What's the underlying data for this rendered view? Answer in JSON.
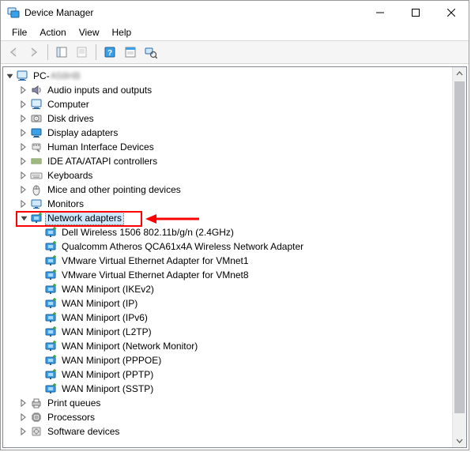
{
  "window": {
    "title": "Device Manager"
  },
  "menu": {
    "file": "File",
    "action": "Action",
    "view": "View",
    "help": "Help"
  },
  "tree": {
    "root": {
      "prefix": "PC-",
      "obscured": "A58HB"
    },
    "cat": {
      "audio": "Audio inputs and outputs",
      "computer": "Computer",
      "disk": "Disk drives",
      "display": "Display adapters",
      "hid": "Human Interface Devices",
      "ide": "IDE ATA/ATAPI controllers",
      "keyboards": "Keyboards",
      "mice": "Mice and other pointing devices",
      "monitors": "Monitors",
      "network": "Network adapters",
      "printq": "Print queues",
      "processors": "Processors",
      "softdev": "Software devices"
    },
    "net": {
      "dell1506": "Dell Wireless 1506 802.11b/g/n (2.4GHz)",
      "qca": "Qualcomm Atheros QCA61x4A Wireless Network Adapter",
      "vmnet1": "VMware Virtual Ethernet Adapter for VMnet1",
      "vmnet8": "VMware Virtual Ethernet Adapter for VMnet8",
      "ikev2": "WAN Miniport (IKEv2)",
      "ip": "WAN Miniport (IP)",
      "ipv6": "WAN Miniport (IPv6)",
      "l2tp": "WAN Miniport (L2TP)",
      "netmon": "WAN Miniport (Network Monitor)",
      "pppoe": "WAN Miniport (PPPOE)",
      "pptp": "WAN Miniport (PPTP)",
      "sstp": "WAN Miniport (SSTP)"
    }
  }
}
